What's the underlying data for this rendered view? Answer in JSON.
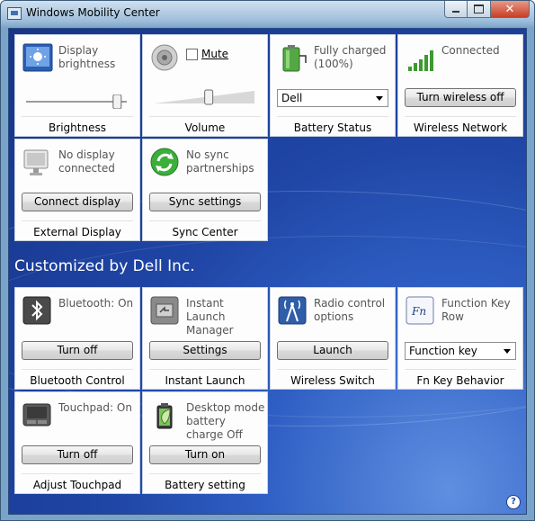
{
  "window": {
    "title": "Windows Mobility Center"
  },
  "tiles": {
    "brightness": {
      "desc": "Display brightness",
      "level": 0.94,
      "label": "Brightness"
    },
    "volume": {
      "mute_label": "Mute",
      "mute_checked": false,
      "level": 0.55,
      "label": "Volume"
    },
    "battery": {
      "desc": "Fully charged (100%)",
      "select_value": "Dell",
      "label": "Battery Status"
    },
    "wireless": {
      "desc": "Connected",
      "button": "Turn wireless off",
      "label": "Wireless Network"
    },
    "external_display": {
      "desc": "No display connected",
      "button": "Connect display",
      "label": "External Display"
    },
    "sync": {
      "desc": "No sync partnerships",
      "button": "Sync settings",
      "label": "Sync Center"
    }
  },
  "section": {
    "title": "Customized by Dell Inc."
  },
  "dell_tiles": {
    "bluetooth": {
      "desc": "Bluetooth: On",
      "button": "Turn off",
      "label": "Bluetooth Control"
    },
    "instant_launch": {
      "desc": "Instant Launch Manager",
      "button": "Settings",
      "label": "Instant Launch"
    },
    "radio": {
      "desc": "Radio control options",
      "button": "Launch",
      "label": "Wireless Switch"
    },
    "fn_key": {
      "desc": "Function Key Row",
      "select_value": "Function key",
      "label": "Fn Key Behavior"
    },
    "touchpad": {
      "desc": "Touchpad: On",
      "button": "Turn off",
      "label": "Adjust Touchpad"
    },
    "battery_setting": {
      "desc": "Desktop mode battery charge Off",
      "button": "Turn on",
      "label": "Battery setting"
    }
  },
  "help": {
    "glyph": "?"
  },
  "icons": {
    "close": "✕"
  }
}
